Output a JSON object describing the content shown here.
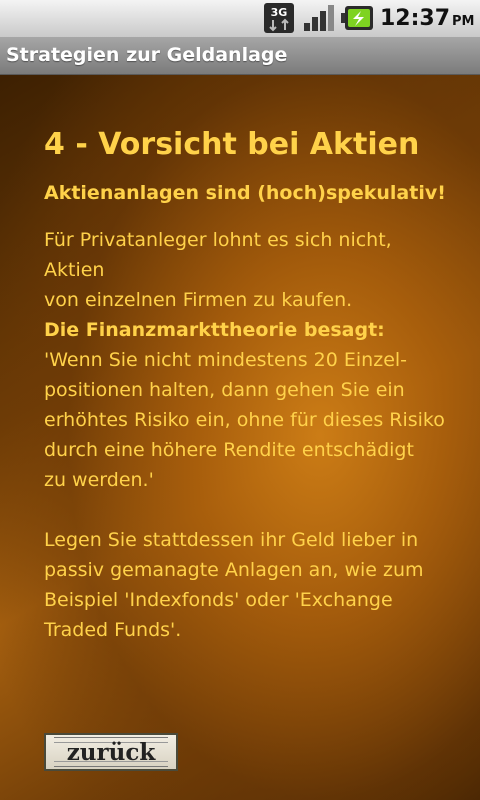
{
  "status_bar": {
    "network": "3G",
    "time": "12:37",
    "ampm": "PM",
    "icons": [
      "3g-data-icon",
      "signal-strength-icon",
      "battery-charging-icon"
    ]
  },
  "app": {
    "title": "Strategien zur Geldanlage"
  },
  "content": {
    "heading": "4 - Vorsicht bei Aktien",
    "subheading": "Aktienanlagen sind (hoch)spekulativ!",
    "paragraph1": "Für Privatanleger lohnt es sich nicht, Aktien\nvon einzelnen Firmen zu kaufen.",
    "paragraph2_label": "Die Finanzmarkttheorie besagt:",
    "paragraph2": "'Wenn Sie nicht mindestens 20 Einzel-\npositionen halten, dann gehen Sie ein\nerhöhtes Risiko ein, ohne für dieses Risiko\ndurch eine höhere Rendite entschädigt\nzu werden.'",
    "paragraph3": "Legen Sie stattdessen ihr Geld lieber in\npassiv gemanagte Anlagen an, wie zum\nBeispiel 'Indexfonds' oder 'Exchange\nTraded Funds'."
  },
  "navigation": {
    "back_label": "zurück"
  },
  "colors": {
    "text": "#ffd24a",
    "background_dark": "#3d2002",
    "background_light": "#c97a16"
  }
}
